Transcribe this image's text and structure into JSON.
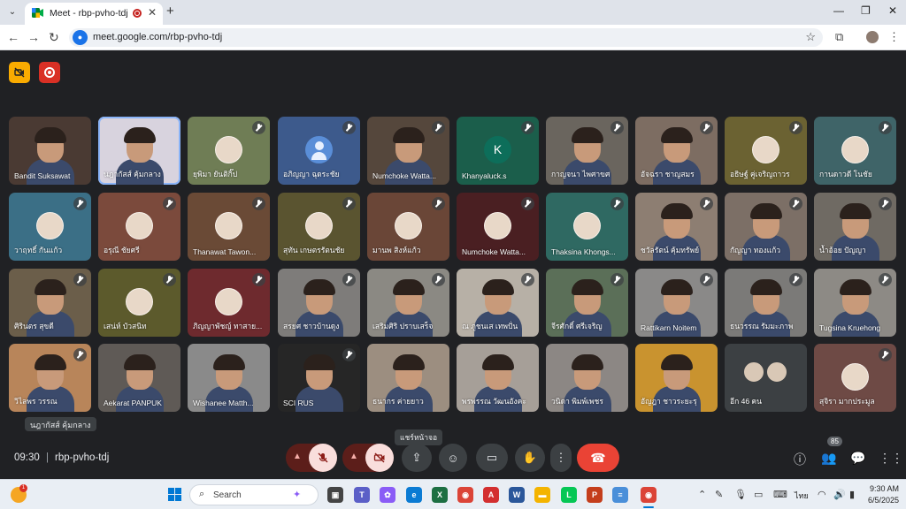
{
  "browser": {
    "tab_title": "Meet - rbp-pvho-tdj",
    "url": "meet.google.com/rbp-pvho-tdj"
  },
  "participants": [
    {
      "name": "Bandit Suksawat",
      "muted": false,
      "kind": "video",
      "bg": "#4a3a33"
    },
    {
      "name": "นฎากัสส์ คุ้มกลาง",
      "muted": false,
      "kind": "video",
      "bg": "#d8d3de",
      "speaking": true
    },
    {
      "name": "ยุพิมา ยันติกิ๊ป",
      "muted": true,
      "kind": "avatar",
      "bg": "#6f7d55"
    },
    {
      "name": "อภิญญา ฉุดระชัย",
      "muted": true,
      "kind": "generic",
      "bg": "#3d5a8c"
    },
    {
      "name": "Numchoke Watta...",
      "muted": true,
      "kind": "video",
      "bg": "#55473c"
    },
    {
      "name": "Khanyaluck.s",
      "muted": true,
      "kind": "letter",
      "letter": "K",
      "bg": "#1b5e4b"
    },
    {
      "name": "กาญจนา ไพศาขศ",
      "muted": true,
      "kind": "video",
      "bg": "#6a655e"
    },
    {
      "name": "อัจฉรา ชาญสมร",
      "muted": true,
      "kind": "video",
      "bg": "#7d6d62"
    },
    {
      "name": "อธิษฐ์ คู่เจริญถาวร",
      "muted": true,
      "kind": "avatar",
      "bg": "#6b6232"
    },
    {
      "name": "กานดาวดี โนชัย",
      "muted": true,
      "kind": "avatar",
      "bg": "#3f6468"
    },
    {
      "name": "วาฤทธิ์ กันแก้ว",
      "muted": true,
      "kind": "avatar",
      "bg": "#3b6f86"
    },
    {
      "name": "อรุณี ชัยศรี",
      "muted": true,
      "kind": "avatar",
      "bg": "#7b4a3c"
    },
    {
      "name": "Thanawat Tawon...",
      "muted": true,
      "kind": "avatar",
      "bg": "#6a4a36"
    },
    {
      "name": "สุทัน เกษตรรัตนชัย",
      "muted": true,
      "kind": "avatar",
      "bg": "#5a5430"
    },
    {
      "name": "มานพ สิงห์แก้ว",
      "muted": true,
      "kind": "avatar",
      "bg": "#6a4637"
    },
    {
      "name": "Numchoke Watta...",
      "muted": true,
      "kind": "avatar",
      "bg": "#4a1f22"
    },
    {
      "name": "Thaksina Khongs...",
      "muted": true,
      "kind": "avatar",
      "bg": "#2f6962"
    },
    {
      "name": "ชวัลรัตน์ คุ้มทรัพย์",
      "muted": true,
      "kind": "video",
      "bg": "#8d7e72"
    },
    {
      "name": "กัญญา ทองแก้ว",
      "muted": true,
      "kind": "video",
      "bg": "#7c6f66"
    },
    {
      "name": "น้ำอ้อย ปัญญา",
      "muted": true,
      "kind": "video",
      "bg": "#6f6a63"
    },
    {
      "name": "ศิรินตร สุขดี",
      "muted": true,
      "kind": "video",
      "bg": "#6b5e4a"
    },
    {
      "name": "เสน่ห์ บัวสนิท",
      "muted": true,
      "kind": "avatar",
      "bg": "#5c5a2c"
    },
    {
      "name": "ภิญญาพัชญ์ ทาสาย...",
      "muted": true,
      "kind": "avatar",
      "bg": "#6e2a2e"
    },
    {
      "name": "สรยศ ชาวบ้านดูง",
      "muted": true,
      "kind": "video",
      "bg": "#7e7c7a"
    },
    {
      "name": "เสริมศิริ ปราบเสร็จ",
      "muted": true,
      "kind": "video",
      "bg": "#8b8983"
    },
    {
      "name": "ณ ภูชนเส เทพปั่น",
      "muted": true,
      "kind": "video",
      "bg": "#b7b0a6"
    },
    {
      "name": "จีรศักดิ์ ศรีเจริญ",
      "muted": true,
      "kind": "video",
      "bg": "#5b6f58"
    },
    {
      "name": "Rattikarn Noitem",
      "muted": true,
      "kind": "video",
      "bg": "#8a8988"
    },
    {
      "name": "ธนวรรณ รัมมะภาพ",
      "muted": true,
      "kind": "video",
      "bg": "#7b7a78"
    },
    {
      "name": "Tugsina Kruehong",
      "muted": true,
      "kind": "video",
      "bg": "#8d8a85"
    },
    {
      "name": "วิไลพร วรรณ",
      "muted": true,
      "kind": "video",
      "bg": "#b8855a"
    },
    {
      "name": "Aekarat PANPUK",
      "muted": false,
      "kind": "video",
      "bg": "#5f5a56"
    },
    {
      "name": "Wishanee Matth...",
      "muted": false,
      "kind": "video",
      "bg": "#8a8a8a"
    },
    {
      "name": "SCI RUS",
      "muted": true,
      "kind": "video",
      "bg": "#262626"
    },
    {
      "name": "ธนากร ค่ายยาว",
      "muted": false,
      "kind": "video",
      "bg": "#9c8e80"
    },
    {
      "name": "พรพรรณ วัฒนอังคะ",
      "muted": false,
      "kind": "video",
      "bg": "#a69f98"
    },
    {
      "name": "วนิดา พิมพ์เพชร",
      "muted": false,
      "kind": "video",
      "bg": "#8c8784"
    },
    {
      "name": "อัญฎา ชาวระยะรุ",
      "muted": false,
      "kind": "video",
      "bg": "#c9932f"
    },
    {
      "name": "อีก 46 คน",
      "muted": false,
      "kind": "more",
      "bg": "#3c4043"
    },
    {
      "name": "สุจิรา มากประมูล",
      "muted": true,
      "kind": "avatar",
      "bg": "#6e4a45"
    }
  ],
  "caption_chip": "นฎากัสส์ คุ้มกลาง",
  "controls": {
    "time": "09:30",
    "separator": "|",
    "meeting_code": "rbp-pvho-tdj",
    "present_tooltip": "แชร์หน้าจอ",
    "people_count": "85"
  },
  "taskbar": {
    "search_placeholder": "Search",
    "weather_badge": "1",
    "language": "ไทย",
    "time": "9:30 AM",
    "date": "6/5/2025"
  },
  "colors": {
    "meet_bg": "#202124",
    "hangup": "#ea4335",
    "muted_pill": "#f9dedc",
    "accent": "#8ab4f8"
  }
}
